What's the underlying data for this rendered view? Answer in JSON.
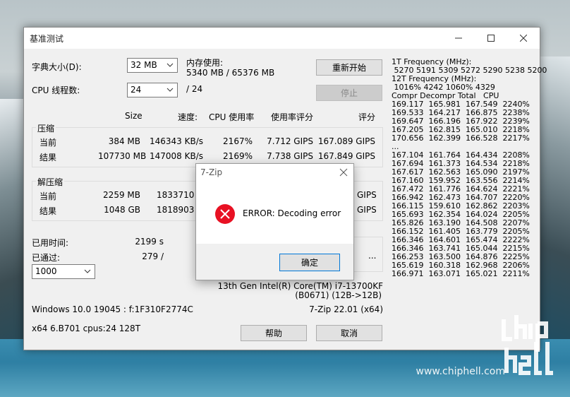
{
  "window": {
    "title": "基准测试"
  },
  "dict": {
    "label": "字典大小(D):",
    "value": "32 MB"
  },
  "threads": {
    "label": "CPU 线程数:",
    "value": "24",
    "total": "/ 24"
  },
  "memory": {
    "label": "内存使用:",
    "value": "5340 MB / 65376 MB"
  },
  "buttons": {
    "restart": "重新开始",
    "stop": "停止",
    "help": "帮助",
    "cancel": "取消",
    "more": "..."
  },
  "headers": {
    "size": "Size",
    "speed": "速度:",
    "cpu_usage": "CPU 使用率",
    "rating_usage": "使用率评分",
    "rating": "评分"
  },
  "compress": {
    "title": "压缩",
    "current": {
      "label": "当前",
      "size": "384 MB",
      "speed": "146343 KB/s",
      "usage": "2167%",
      "ru": "7.712 GIPS",
      "rating": "167.089 GIPS"
    },
    "result": {
      "label": "结果",
      "size": "107730 MB",
      "speed": "147008 KB/s",
      "usage": "2169%",
      "ru": "7.738 GIPS",
      "rating": "167.849 GIPS"
    }
  },
  "decompress": {
    "title": "解压缩",
    "current": {
      "label": "当前",
      "size": "2259 MB",
      "speed": "1833710 KB/",
      "rating": "GIPS"
    },
    "result": {
      "label": "结果",
      "size": "1048 GB",
      "speed": "1818903 KB/",
      "rating": "GIPS"
    }
  },
  "elapsed": {
    "label": "已用时间:",
    "value": "2199 s"
  },
  "passed": {
    "label": "已通过:",
    "value": "279 /"
  },
  "passes_select": "1000",
  "cpu_info": {
    "line1": "13th Gen Intel(R) Core(TM) i7-13700KF",
    "line2": "(B0671) (12B->12B)"
  },
  "os_info": "Windows 10.0 19045 : f:1F310F2774C",
  "zip_version": "7-Zip 22.01 (x64)",
  "arch_info": "x64 6.B701 cpus:24 128T",
  "right_panel": [
    "1T Frequency (MHz):",
    " 5270 5191 5309 5272 5290 5238 5200",
    "12T Frequency (MHz):",
    " 1016% 4242 1060% 4329",
    "Compr Decompr Total   CPU",
    "169.117  165.981  167.549  2240%",
    "169.533  164.217  166.875  2238%",
    "169.647  166.196  167.922  2239%",
    "167.205  162.815  165.010  2218%",
    "170.656  162.399  166.528  2217%",
    "...",
    "167.104  161.764  164.434  2208%",
    "167.694  161.373  164.534  2218%",
    "167.617  162.563  165.090  2197%",
    "167.160  159.952  163.556  2214%",
    "167.472  161.776  164.624  2221%",
    "166.942  162.473  164.707  2220%",
    "166.115  159.610  162.862  2203%",
    "165.693  162.354  164.024  2205%",
    "165.826  163.190  164.508  2207%",
    "166.152  161.405  163.779  2205%",
    "166.346  164.601  165.474  2222%",
    "166.346  163.741  165.044  2215%",
    "166.253  163.500  164.876  2225%",
    "165.619  160.318  162.968  2206%",
    "166.971  163.071  165.021  2211%"
  ],
  "dialog": {
    "title": "7-Zip",
    "message": "ERROR: Decoding error",
    "ok": "确定"
  },
  "watermark": {
    "url": "www.chiphell.com"
  }
}
